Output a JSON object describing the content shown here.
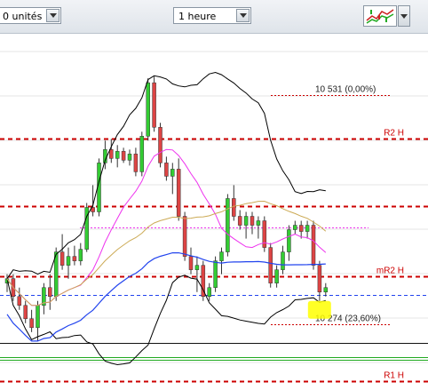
{
  "toolbar": {
    "units_value": "0 unités",
    "interval_value": "1 heure",
    "indicator_icon": "chart-indicator-icon"
  },
  "chart_data": {
    "type": "candlestick",
    "colors": {
      "up": "#33cc33",
      "down": "#dd4444",
      "bollinger": "#000000",
      "ma_fast": "#ee33ee",
      "ma_mid": "#ccaa55",
      "ma_slow": "#2244ee",
      "pivot": "#cc0000",
      "marker": "#ffff00"
    },
    "y_scale": {
      "price_min": 10200,
      "price_max": 10600
    },
    "candles": [
      [
        10320,
        10330,
        10310,
        10325
      ],
      [
        10325,
        10330,
        10300,
        10305
      ],
      [
        10305,
        10315,
        10290,
        10295
      ],
      [
        10295,
        10300,
        10275,
        10280
      ],
      [
        10280,
        10290,
        10265,
        10270
      ],
      [
        10270,
        10300,
        10255,
        10295
      ],
      [
        10295,
        10320,
        10285,
        10315
      ],
      [
        10315,
        10330,
        10290,
        10305
      ],
      [
        10305,
        10360,
        10300,
        10355
      ],
      [
        10355,
        10375,
        10335,
        10340
      ],
      [
        10340,
        10360,
        10325,
        10350
      ],
      [
        10350,
        10362,
        10340,
        10345
      ],
      [
        10345,
        10365,
        10340,
        10358
      ],
      [
        10358,
        10410,
        10355,
        10405
      ],
      [
        10405,
        10430,
        10395,
        10400
      ],
      [
        10400,
        10460,
        10395,
        10455
      ],
      [
        10455,
        10480,
        10448,
        10470
      ],
      [
        10470,
        10482,
        10455,
        10460
      ],
      [
        10460,
        10475,
        10450,
        10468
      ],
      [
        10468,
        10472,
        10455,
        10458
      ],
      [
        10458,
        10470,
        10452,
        10465
      ],
      [
        10465,
        10472,
        10440,
        10445
      ],
      [
        10445,
        10490,
        10440,
        10485
      ],
      [
        10485,
        10550,
        10480,
        10545
      ],
      [
        10545,
        10552,
        10490,
        10495
      ],
      [
        10495,
        10500,
        10450,
        10455
      ],
      [
        10455,
        10462,
        10435,
        10440
      ],
      [
        10440,
        10455,
        10420,
        10448
      ],
      [
        10448,
        10460,
        10390,
        10395
      ],
      [
        10395,
        10400,
        10345,
        10350
      ],
      [
        10350,
        10360,
        10330,
        10335
      ],
      [
        10335,
        10350,
        10310,
        10340
      ],
      [
        10340,
        10345,
        10300,
        10305
      ],
      [
        10305,
        10320,
        10300,
        10315
      ],
      [
        10315,
        10350,
        10310,
        10345
      ],
      [
        10345,
        10360,
        10330,
        10355
      ],
      [
        10355,
        10420,
        10350,
        10415
      ],
      [
        10415,
        10430,
        10390,
        10395
      ],
      [
        10395,
        10402,
        10380,
        10385
      ],
      [
        10385,
        10400,
        10370,
        10395
      ],
      [
        10395,
        10400,
        10375,
        10385
      ],
      [
        10385,
        10395,
        10370,
        10390
      ],
      [
        10390,
        10395,
        10355,
        10360
      ],
      [
        10360,
        10365,
        10315,
        10320
      ],
      [
        10320,
        10340,
        10315,
        10335
      ],
      [
        10335,
        10362,
        10330,
        10355
      ],
      [
        10355,
        10385,
        10345,
        10380
      ],
      [
        10380,
        10390,
        10375,
        10385
      ],
      [
        10385,
        10390,
        10370,
        10378
      ],
      [
        10378,
        10390,
        10370,
        10385
      ],
      [
        10385,
        10390,
        10335,
        10340
      ],
      [
        10340,
        10345,
        10300,
        10310
      ],
      [
        10310,
        10320,
        10305,
        10315
      ]
    ],
    "h_lines": [
      {
        "name": "level-10531",
        "price": 10531,
        "color": "#cc0000",
        "style": "dotted",
        "label": "10 531 (0,00%)",
        "underline": true
      },
      {
        "name": "r2h",
        "price": 10482,
        "color": "#cc0000",
        "style": "dashed-thick",
        "label": "R2 H"
      },
      {
        "name": "mid-resistance",
        "price": 10406,
        "color": "#cc0000",
        "style": "dashed-thick",
        "label": ""
      },
      {
        "name": "pink-dotted",
        "price": 10383,
        "color": "#ee33ee",
        "style": "dotted",
        "label": ""
      },
      {
        "name": "mr2h",
        "price": 10328,
        "color": "#cc0000",
        "style": "dashed-thick",
        "label": "mR2 H"
      },
      {
        "name": "blue-dashed",
        "price": 10307,
        "color": "#2244ee",
        "style": "dashed",
        "label": ""
      },
      {
        "name": "black-support",
        "price": 10253,
        "color": "#111111",
        "style": "solid",
        "label": ""
      },
      {
        "name": "green-support",
        "price": 10237,
        "color": "#22aa22",
        "style": "solid-double",
        "label": ""
      },
      {
        "name": "level-10274",
        "price": 10274,
        "color": "#cc0000",
        "style": "dotted",
        "label": "10 274 (23,60%)",
        "underline": true
      },
      {
        "name": "r1h",
        "price": 10210,
        "color": "#cc0000",
        "style": "dashed-thick",
        "label": "R1 H"
      }
    ]
  }
}
